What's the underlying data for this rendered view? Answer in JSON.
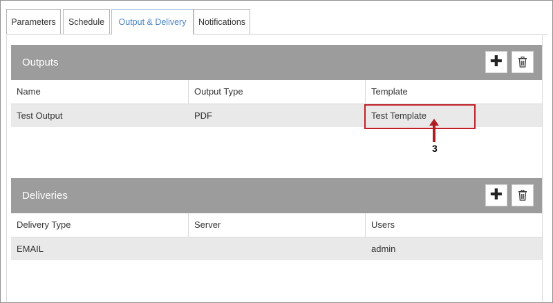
{
  "tabs": [
    {
      "label": "Parameters",
      "active": false
    },
    {
      "label": "Schedule",
      "active": false
    },
    {
      "label": "Output & Delivery",
      "active": true
    },
    {
      "label": "Notifications",
      "active": false
    }
  ],
  "outputs": {
    "title": "Outputs",
    "columns": [
      "Name",
      "Output Type",
      "Template"
    ],
    "rows": [
      [
        "Test Output",
        "PDF",
        "Test Template"
      ]
    ]
  },
  "deliveries": {
    "title": "Deliveries",
    "columns": [
      "Delivery Type",
      "Server",
      "Users"
    ],
    "rows": [
      [
        "EMAIL",
        "",
        "admin"
      ]
    ]
  },
  "annotation": {
    "number": "3",
    "color": "#c0202a"
  },
  "colors": {
    "panel_header": "#9c9c9c",
    "active_tab": "#4a84c4",
    "row_bg": "#e9e9e9"
  },
  "icons": {
    "add": "plus-icon",
    "delete": "trash-icon"
  }
}
